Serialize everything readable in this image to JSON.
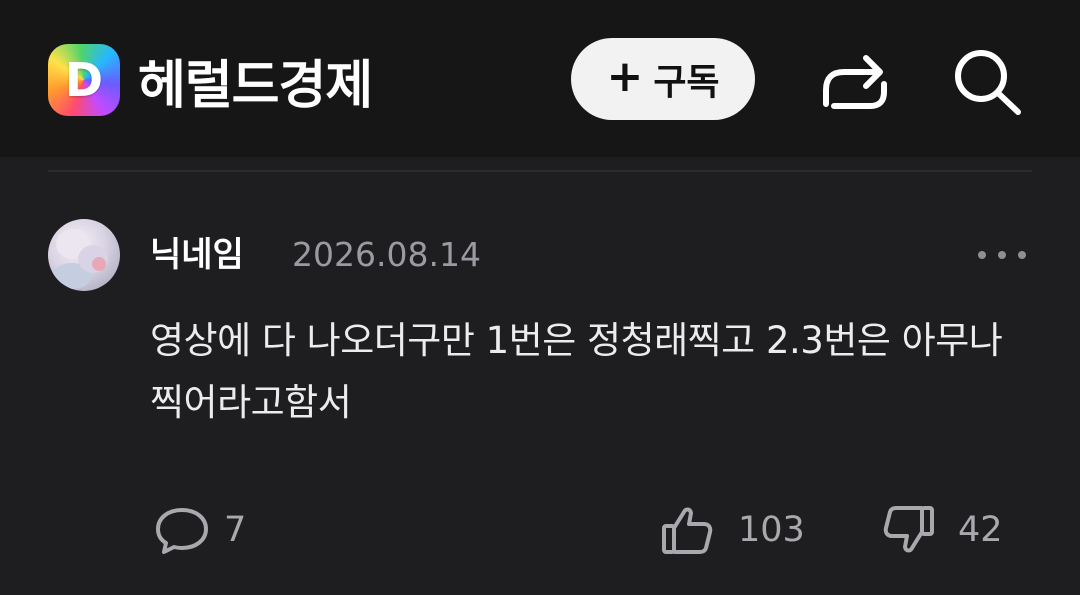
{
  "header": {
    "logo_letter": "D",
    "publisher_name": "헤럴드경제",
    "subscribe_label": "구독",
    "subscribe_icon": "plus-icon",
    "share_icon": "share-icon",
    "search_icon": "search-icon"
  },
  "comment": {
    "nickname": "닉네임",
    "date": "2026.08.14",
    "more_icon": "more-icon",
    "text": "영상에 다 나오더구만 1번은 정청래찍고 2.3번은 아무나 찍어라고함서",
    "reply_count": "7",
    "like_count": "103",
    "dislike_count": "42"
  },
  "colors": {
    "header_bg": "#161617",
    "page_bg": "#1e1e20",
    "text_primary": "#ffffff",
    "text_secondary": "#9a9aa0",
    "subscribe_bg": "#f2f2f2"
  }
}
